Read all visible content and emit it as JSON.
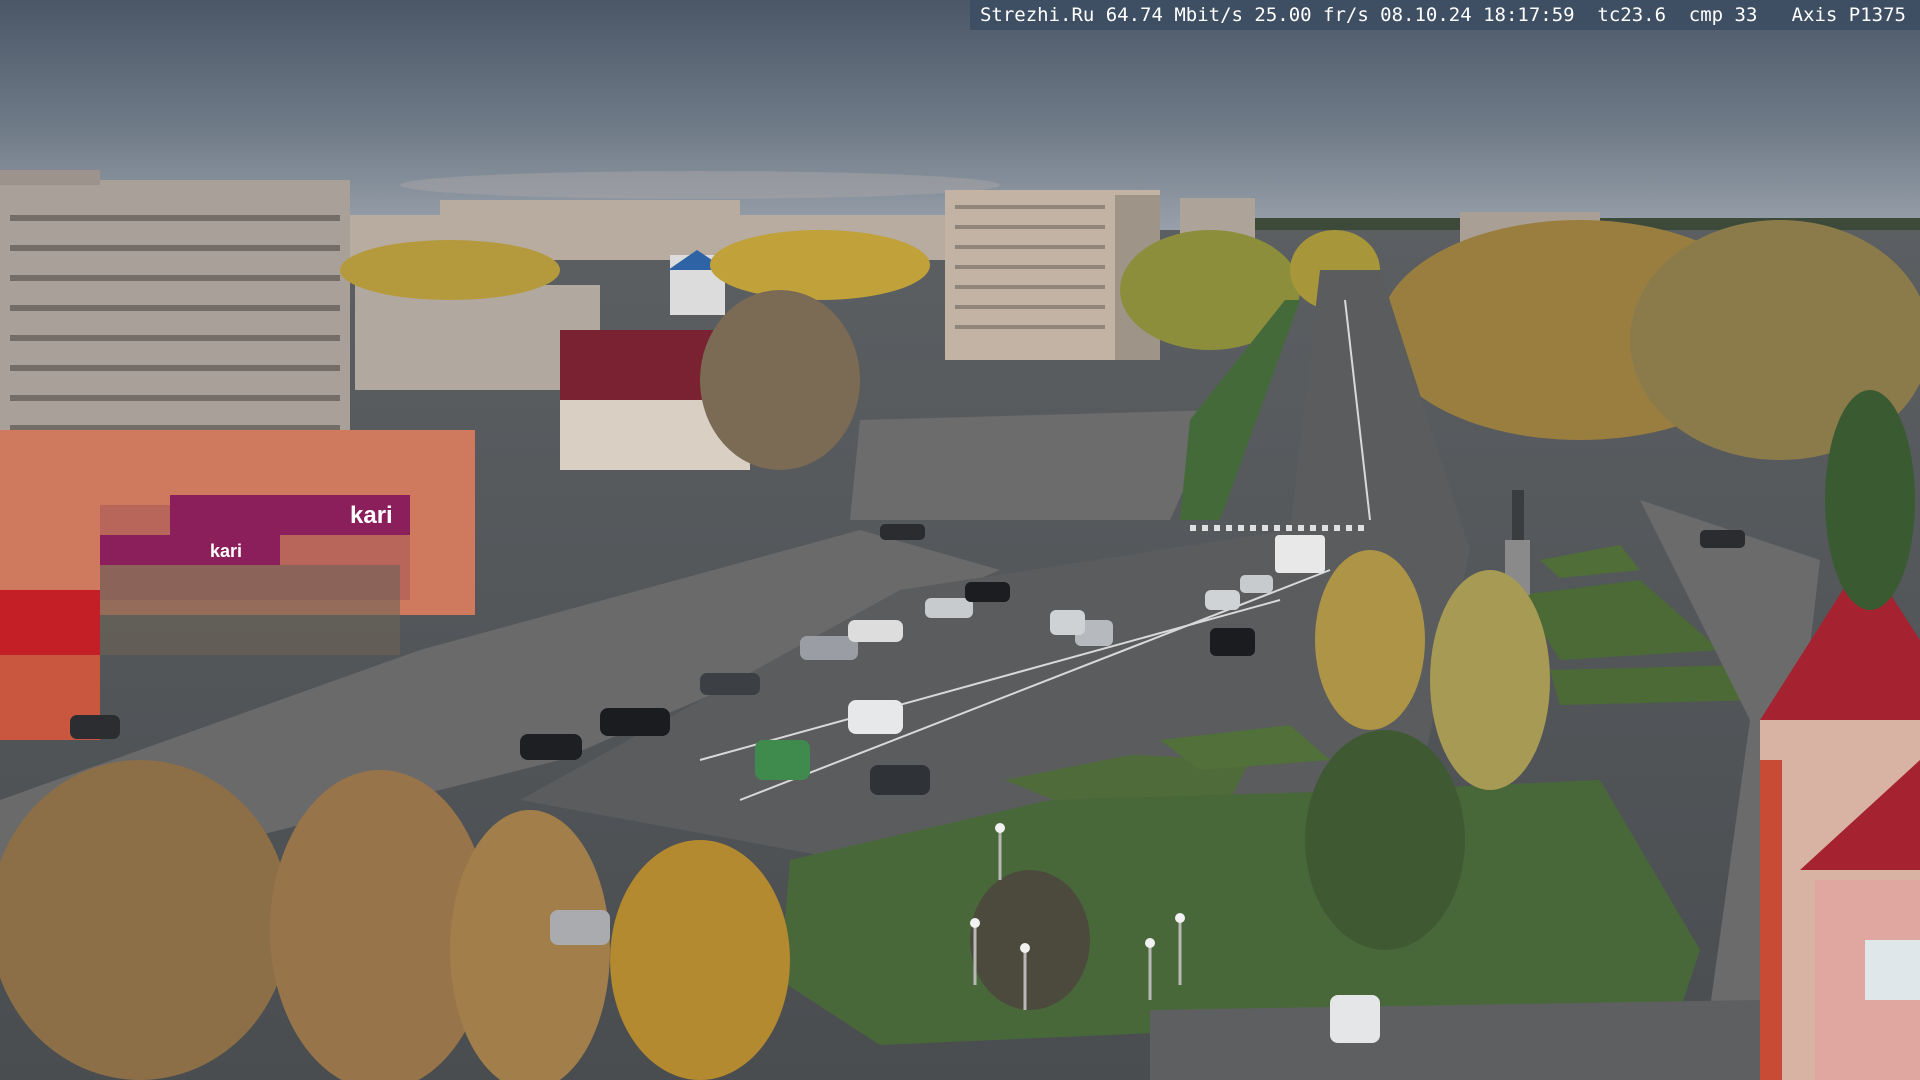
{
  "overlay": {
    "site": "Strezhi.Ru",
    "bitrate": "64.74 Mbit/s",
    "framerate": "25.00 fr/s",
    "date": "08.10.24",
    "time": "18:17:59",
    "tc": "tc23.6",
    "cmp": "cmp 33",
    "camera": "Axis P1375"
  },
  "signs": {
    "store": "kari",
    "store_sub": "kari"
  },
  "colors": {
    "sky_top": "#4d5968",
    "sky_horizon": "#8e98a3",
    "overlay_bg": "#3f4f63",
    "store_accent": "#8a1f5c",
    "roof_red": "#a52330"
  }
}
